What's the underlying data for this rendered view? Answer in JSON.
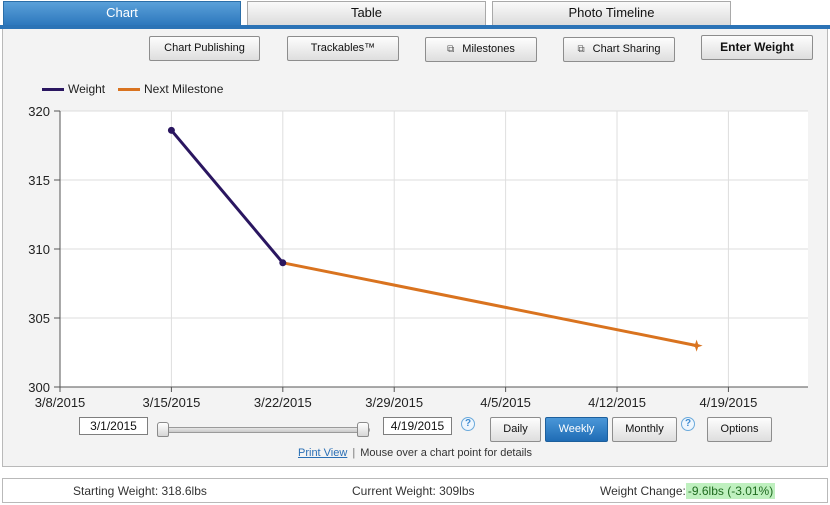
{
  "tabs": [
    {
      "label": "Chart",
      "active": true
    },
    {
      "label": "Table",
      "active": false
    },
    {
      "label": "Photo Timeline",
      "active": false
    }
  ],
  "toolbar": {
    "chart_publishing": "Chart Publishing",
    "trackables": "Trackables™",
    "milestones": "Milestones",
    "chart_sharing": "Chart Sharing",
    "enter_weight": "Enter Weight"
  },
  "legend": {
    "weight": "Weight",
    "next_milestone": "Next Milestone"
  },
  "colors": {
    "weight": "#2a1660",
    "milestone": "#d9731f",
    "accent": "#2b73b6"
  },
  "chart_data": {
    "type": "line",
    "title": "",
    "xlabel": "",
    "ylabel": "",
    "x_ticks": [
      "3/8/2015",
      "3/15/2015",
      "3/22/2015",
      "3/29/2015",
      "4/5/2015",
      "4/12/2015",
      "4/19/2015"
    ],
    "y_ticks": [
      300,
      305,
      310,
      315,
      320
    ],
    "xlim": [
      "3/8/2015",
      "4/24/2015"
    ],
    "ylim": [
      300,
      320
    ],
    "grid": true,
    "legend_position": "top-left",
    "series": [
      {
        "name": "Weight",
        "points": [
          {
            "x": "3/15/2015",
            "y": 318.6
          },
          {
            "x": "3/22/2015",
            "y": 309
          }
        ]
      },
      {
        "name": "Next Milestone",
        "points": [
          {
            "x": "3/22/2015",
            "y": 309
          },
          {
            "x": "4/17/2015",
            "y": 303
          }
        ]
      }
    ]
  },
  "range": {
    "start": "3/1/2015",
    "end": "4/19/2015",
    "help": "?"
  },
  "period": {
    "daily": "Daily",
    "weekly": "Weekly",
    "monthly": "Monthly",
    "selected": "Weekly",
    "help": "?"
  },
  "options_label": "Options",
  "footer": {
    "print_view": "Print View",
    "separator": "|",
    "hint": "Mouse over a chart point for details"
  },
  "summary": {
    "starting_label": "Starting Weight:",
    "starting_value": "318.6lbs",
    "current_label": "Current Weight:",
    "current_value": "309lbs",
    "change_label": "Weight Change:",
    "change_value": "-9.6lbs (-3.01%)"
  }
}
